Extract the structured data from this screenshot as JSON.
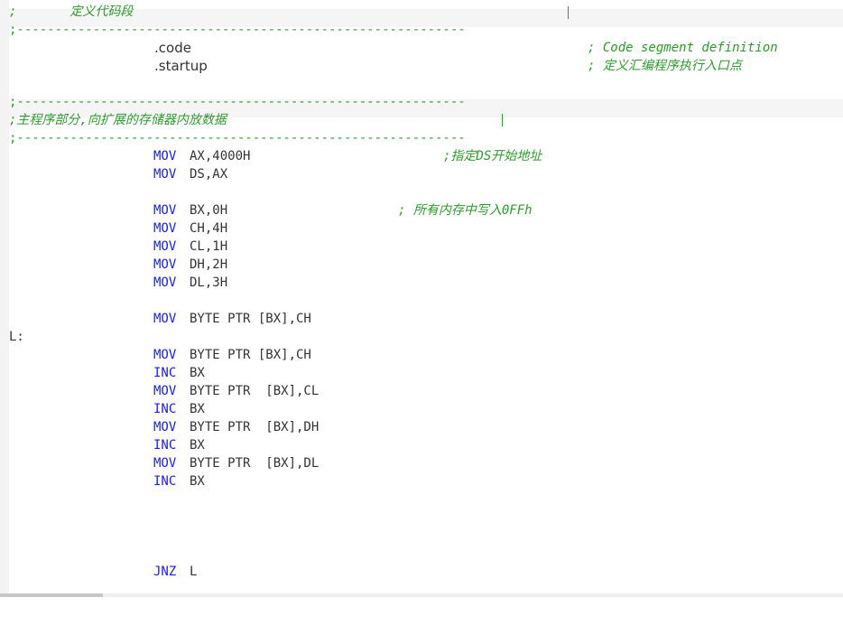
{
  "editor": {
    "lines": {
      "l1_comment": ";       定义代码段",
      "l2_rule": ";-----------------------------------------------------------",
      "l3_code": ".code",
      "l3_comment": "; Code segment definition",
      "l4_startup": ".startup",
      "l4_comment": "; 定义汇编程序执行入口点",
      "l6_rule": ";-----------------------------------------------------------",
      "l7_comment": ";主程序部分,向扩展的存储器内放数据",
      "l8_rule": ";-----------------------------------------------------------",
      "l9_kw": "MOV",
      "l9_args": "AX,4000H",
      "l9_comment": ";指定DS开始地址",
      "l10_kw": "MOV",
      "l10_args": "DS,AX",
      "l12_kw": "MOV",
      "l12_args": "BX,0H",
      "l12_comment": "; 所有内存中写入0FFh",
      "l13_kw": "MOV",
      "l13_args": "CH,4H",
      "l14_kw": "MOV",
      "l14_args": "CL,1H",
      "l15_kw": "MOV",
      "l15_args": "DH,2H",
      "l16_kw": "MOV",
      "l16_args": "DL,3H",
      "l18_kw": "MOV",
      "l18_args": "BYTE PTR [BX],CH",
      "l19_label": "L:",
      "l20_kw": "MOV",
      "l20_args": "BYTE PTR [BX],CH",
      "l21_kw": "INC",
      "l21_args": "BX",
      "l22_kw": "MOV",
      "l22_args": "BYTE PTR  [BX],CL",
      "l23_kw": "INC",
      "l23_args": "BX",
      "l24_kw": "MOV",
      "l24_args": "BYTE PTR  [BX],DH",
      "l25_kw": "INC",
      "l25_args": "BX",
      "l26_kw": "MOV",
      "l26_args": "BYTE PTR  [BX],DL",
      "l27_kw": "INC",
      "l27_args": "BX",
      "l32_kw": "JNZ",
      "l32_args": "L"
    }
  },
  "colors": {
    "comment": "#2e9a2e",
    "keyword": "#1a1aff",
    "text": "#333333"
  }
}
